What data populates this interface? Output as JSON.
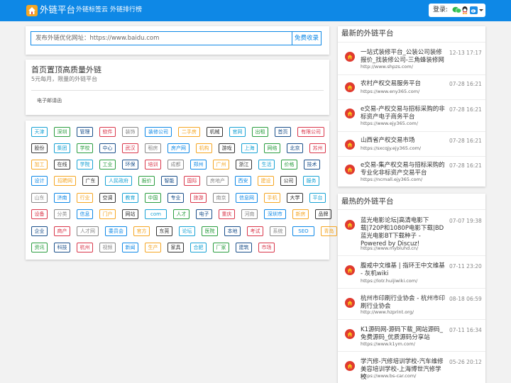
{
  "header": {
    "brand": "外链平台",
    "nav": [
      "外链标签云",
      "外链排行榜"
    ],
    "login_label": "登录:"
  },
  "search": {
    "placeholder": "发布外链优化网址：https://www.baidu.com",
    "button": "免费收录"
  },
  "promo": {
    "title": "首页置顶高质量外链",
    "subtitle": "5元每月，限量的外链平台",
    "email_label": "电子邮请函"
  },
  "tags": [
    [
      "天津",
      "深圳",
      "管理",
      "软件",
      "装饰",
      "装修公司",
      "二手房",
      "机械",
      "官网",
      "出租",
      "首页",
      "有限公司"
    ],
    [
      "股份",
      "集团",
      "学校",
      "中心",
      "武汉",
      "租房",
      "房产网",
      "机构",
      "游戏",
      "上海",
      "网络",
      "北京",
      "苏州"
    ],
    [
      "加工",
      "在线",
      "学院",
      "工业",
      "环保",
      "培训",
      "成都",
      "郑州",
      "广州",
      "浙江",
      "生活",
      "价格",
      "技术"
    ],
    [
      "设计",
      "招聘网",
      "广东",
      "人民政府",
      "报价",
      "智能",
      "国际",
      "房地产",
      "西安",
      "建设",
      "公司",
      "服务"
    ],
    [
      "山东",
      "济南",
      "行业",
      "空调",
      "教育",
      "中国",
      "专业",
      "旅游",
      "南京",
      "信息网",
      "手机",
      "大学",
      "平台"
    ],
    [
      "设备",
      "分类",
      "信息",
      "门户",
      "网站",
      "com",
      "人才",
      "电子",
      "重庆",
      "河南",
      "深圳市",
      "新房",
      "品牌"
    ],
    [
      "企业",
      "商产",
      "人才网",
      "委员会",
      "官方",
      "东莞",
      "论坛",
      "医院",
      "本地",
      "考试",
      "系统",
      "SEO",
      "青岛"
    ],
    [
      "资讯",
      "科技",
      "杭州",
      "视频",
      "新闻",
      "生产",
      "家具",
      "合肥",
      "厂家",
      "建筑",
      "市场"
    ]
  ],
  "latest": {
    "heading": "最新的外链平台",
    "items": [
      {
        "title": "一站式装修平台_公装公司装修报价_找装修公司-三角蜂装修网",
        "date": "12-13 17:17",
        "url": "http://www.shpzs.com/"
      },
      {
        "title": "农村产权交易服务平台",
        "date": "07-28 16:21",
        "url": "https://www.eny365.com/"
      },
      {
        "title": "e交易-产权交易与招标采购的非标资产电子商务平台",
        "date": "07-28 16:21",
        "url": "https://www.ejy365.com/"
      },
      {
        "title": "山西省产权交易市场",
        "date": "07-28 16:21",
        "url": "https://sxcqjy.ejy365.com/"
      },
      {
        "title": "e交易-集产权交易与招标采购的专业化非标资产交易平台",
        "date": "07-28 16:21",
        "url": "https://ncmall.ejy365.com/"
      }
    ]
  },
  "hottest": {
    "heading": "最热的外链平台",
    "items": [
      {
        "title": "蓝光电影论坛|高清电影下载|720P和1080P电影下载|BD蓝光电影BT下载种子 - Powered by Discuz!",
        "date": "07-07 19:38",
        "url": "https://www.mybluhd.cn/"
      },
      {
        "title": "腹戒中文维基 | 指环王中文维基 - 灰机wiki",
        "date": "07-11 23:20",
        "url": "https://lotr.huijiwiki.com/"
      },
      {
        "title": "杭州市印刷行业协会 - 杭州市印刷行业协会",
        "date": "08-18 06:59",
        "url": "http://www.hzprint.org/"
      },
      {
        "title": "K1源码网-源码下载_网站源码_免费源码_优质源码分享站",
        "date": "07-11 16:34",
        "url": "https://www.k1ym.com/"
      },
      {
        "title": "学汽修-汽修培训学校-汽车维修美容培训学校-上海博世汽修学校",
        "date": "05-26 20:12",
        "url": "https://www.bs-car.com/"
      }
    ]
  },
  "colors": {
    "primary": "#0e88e6",
    "tag_cycle": [
      "#18a2d4",
      "#0e88e6",
      "#1a4f8a",
      "#333333",
      "#888888",
      "#2a9d3f",
      "#f5a623",
      "#d9364a"
    ]
  },
  "icons": {
    "logo": "house-logo-icon",
    "login": [
      "wechat-icon",
      "qq-icon",
      "weibo-icon",
      "chevron-down-icon"
    ],
    "site": "site-favicon-icon"
  }
}
